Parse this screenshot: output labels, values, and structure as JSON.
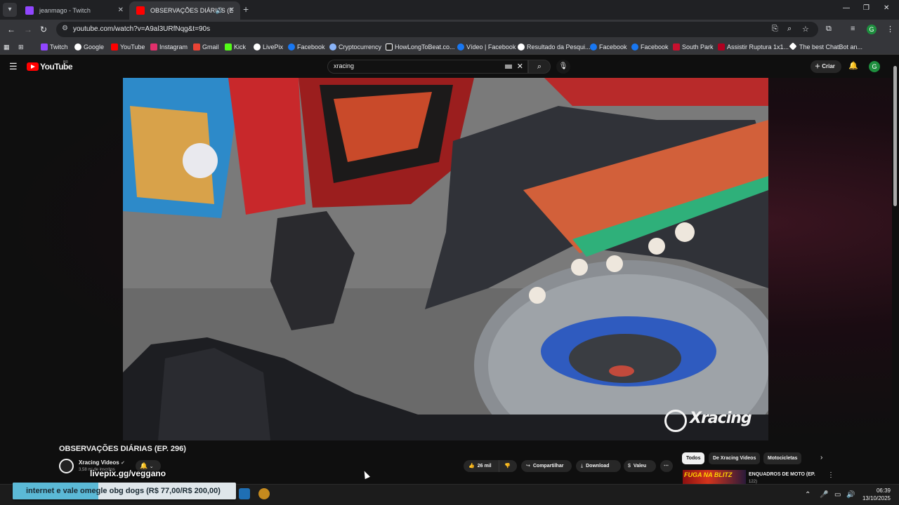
{
  "browser": {
    "tabs": [
      {
        "title": "jeanmago - Twitch",
        "active": false,
        "favicon_color": "#9146ff"
      },
      {
        "title": "OBSERVAÇÕES DIÁRIAS (E",
        "active": true,
        "favicon_color": "#ff0000"
      }
    ],
    "new_tab_glyph": "+",
    "url": "youtube.com/watch?v=A9al3URfNqg&t=90s",
    "bookmarks": [
      {
        "label": "Twitch",
        "icon": "twitch-icon",
        "color": "#9146ff"
      },
      {
        "label": "Google",
        "icon": "google-icon",
        "color": "#ffffff"
      },
      {
        "label": "YouTube",
        "icon": "youtube-icon",
        "color": "#ff0000"
      },
      {
        "label": "Instagram",
        "icon": "instagram-icon",
        "color": "#e1306c"
      },
      {
        "label": "Gmail",
        "icon": "gmail-icon",
        "color": "#ea4335"
      },
      {
        "label": "Kick",
        "icon": "kick-icon",
        "color": "#53fc18"
      },
      {
        "label": "LivePix",
        "icon": "livepix-icon",
        "color": "#ffffff"
      },
      {
        "label": "Facebook",
        "icon": "facebook-icon",
        "color": "#1877f2"
      },
      {
        "label": "Cryptocurrency",
        "icon": "crypto-icon",
        "color": "#8ab4f8"
      },
      {
        "label": "HowLongToBeat.co...",
        "icon": "hltb-icon",
        "color": "#222222"
      },
      {
        "label": "Vídeo | Facebook",
        "icon": "facebook-icon",
        "color": "#1877f2"
      },
      {
        "label": "Resultado da Pesqui...",
        "icon": "globe-icon",
        "color": "#ffffff"
      },
      {
        "label": "Facebook",
        "icon": "facebook-icon",
        "color": "#1877f2"
      },
      {
        "label": "Facebook",
        "icon": "facebook-icon",
        "color": "#1877f2"
      },
      {
        "label": "South Park",
        "icon": "southpark-icon",
        "color": "#c8102e"
      },
      {
        "label": "Assistir Ruptura 1x1...",
        "icon": "ruptura-icon",
        "color": "#b00020"
      },
      {
        "label": "The best ChatBot an...",
        "icon": "chatbot-icon",
        "color": "#ffffff"
      }
    ]
  },
  "youtube": {
    "logo_text": "YouTube",
    "country_code": "BR",
    "search_query": "xracing",
    "create_label": "Criar",
    "avatar_letter": "G"
  },
  "video": {
    "title": "OBSERVAÇÕES DIÁRIAS (EP. 296)",
    "watermark": "Xracing",
    "channel_name": "Xracing Videos",
    "channel_subs": "3,58 mi de inscritos",
    "likes": "26 mil",
    "share_label": "Compartilhar",
    "download_label": "Download",
    "thanks_label": "Valeu"
  },
  "sidebar": {
    "chips": [
      "Todos",
      "De Xracing Videos",
      "Motocicletas"
    ],
    "rec_title": "ENQUADROS DE MOTO (EP.",
    "rec_sub": "122)",
    "rec_thumb_text": "FUGA NA BLITZ"
  },
  "overlay": {
    "link_text": "livepix.gg/veggano",
    "banner_text": "internet e vale omegle obg dogs (R$ 77,00/R$ 200,00)",
    "banner_progress": 0.385
  },
  "taskbar": {
    "time": "06:39",
    "date": "13/10/2025"
  },
  "colors": {
    "accent_red": "#ff0000",
    "bg": "#0f0f0f",
    "banner_fill": "#5bb9d6"
  }
}
